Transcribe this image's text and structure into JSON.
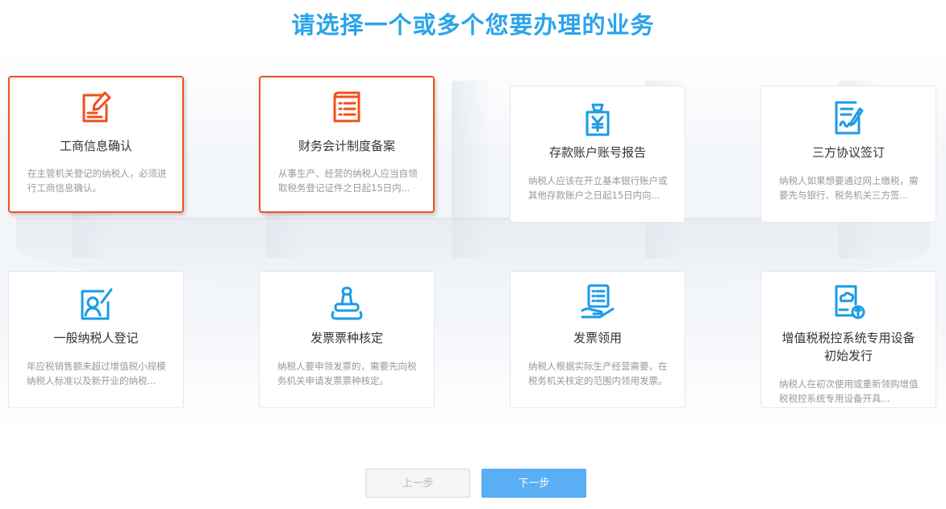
{
  "page": {
    "title": "请选择一个或多个您要办理的业务"
  },
  "colors": {
    "title": "#2aa4ea",
    "selected_border": "#f0501c",
    "icon_selected": "#f0501c",
    "icon_default": "#1a9be6",
    "next_button": "#5aaef4"
  },
  "cards": [
    {
      "title": "工商信息确认",
      "desc": "在主管机关登记的纳税人，必须进行工商信息确认。",
      "icon": "edit-form-icon",
      "selected": true
    },
    {
      "title": "财务会计制度备案",
      "desc": "从事生产、经营的纳税人应当自领取税务登记证件之日起15日内...",
      "icon": "document-list-icon",
      "selected": true
    },
    {
      "title": "存款账户账号报告",
      "desc": "纳税人应该在开立基本银行账户或其他存款账户之日起15日内向...",
      "icon": "yuan-bag-icon",
      "selected": false
    },
    {
      "title": "三方协议签订",
      "desc": "纳税人如果想要通过网上缴税，需要先与银行、税务机关三方签...",
      "icon": "sign-contract-icon",
      "selected": false
    },
    {
      "title": "一般纳税人登记",
      "desc": "年应税销售额未超过增值税小规模纳税人标准以及新开业的纳税...",
      "icon": "user-register-icon",
      "selected": false
    },
    {
      "title": "发票票种核定",
      "desc": "纳税人要申领发票的，需要先向税务机关申请发票票种核定。",
      "icon": "stamp-icon",
      "selected": false
    },
    {
      "title": "发票领用",
      "desc": "纳税人根据实际生产经营需要，在税务机关核定的范围内领用发票。",
      "icon": "receive-invoice-icon",
      "selected": false
    },
    {
      "title": "增值税税控系统专用设备初始发行",
      "desc": "纳税人在初次使用或重新领购增值税税控系统专用设备开具...",
      "icon": "cloud-device-icon",
      "selected": false
    }
  ],
  "buttons": {
    "prev_label": "上一步",
    "next_label": "下一步"
  }
}
